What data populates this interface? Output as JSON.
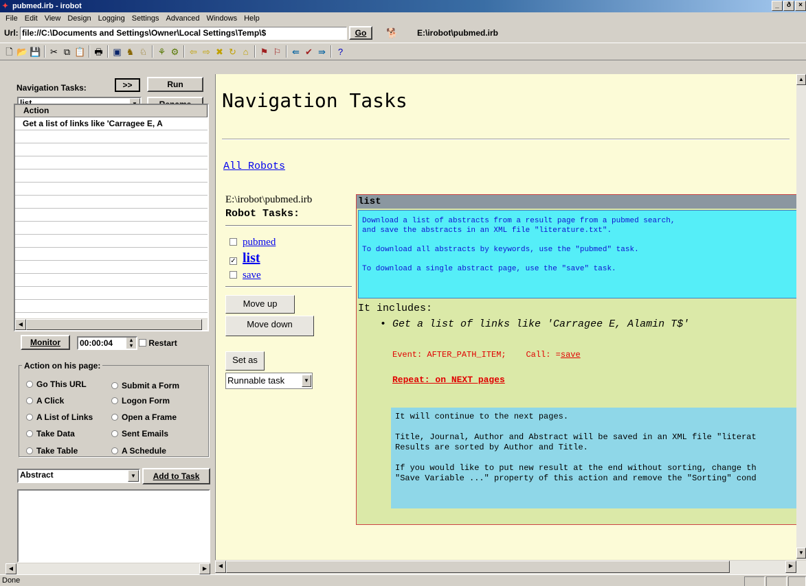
{
  "window": {
    "title": "pubmed.irb - irobot",
    "min": "_",
    "max": "ð",
    "close": "×"
  },
  "menu": [
    "File",
    "Edit",
    "View",
    "Design",
    "Logging",
    "Settings",
    "Advanced",
    "Windows",
    "Help"
  ],
  "urlbar": {
    "label": "Url:",
    "value": "file://C:\\Documents and Settings\\Owner\\Local Settings\\Temp\\$",
    "go": "Go",
    "path": "E:\\irobot\\pubmed.irb"
  },
  "left": {
    "nav_label": "Navigation Tasks:",
    "expand": ">>",
    "run": "Run",
    "task_combo": "list",
    "rename": "Rename",
    "action_header": "Action",
    "action_rows": [
      "Get a list of links like 'Carragee E, A"
    ],
    "monitor": "Monitor",
    "time": "00:00:04",
    "restart": "Restart",
    "group_label": "Action on his page:",
    "radios": [
      [
        "Go This URL",
        "Submit a Form"
      ],
      [
        "A Click",
        "Logon Form"
      ],
      [
        "A List of Links",
        "Open a Frame"
      ],
      [
        "Take Data",
        "Sent Emails"
      ],
      [
        "Take Table",
        "A Schedule"
      ]
    ],
    "data_combo": "Abstract",
    "add_task": "Add to Task"
  },
  "content": {
    "heading": "Navigation Tasks",
    "all_robots": "All Robots",
    "robot_path": "E:\\irobot\\pubmed.irb",
    "robot_tasks": "Robot Tasks:",
    "tasks": [
      {
        "name": "pubmed",
        "checked": false
      },
      {
        "name": "list",
        "checked": true
      },
      {
        "name": "save",
        "checked": false
      }
    ],
    "move_up": "Move up",
    "move_down": "Move down",
    "set_as": "Set as",
    "runnable": "Runnable task",
    "panel_title": "list",
    "description_lines": [
      "Download a list of abstracts from a result page from a pubmed search,",
      "and save the abstracts in an XML file \"literature.txt\".",
      "",
      "To download all abstracts by keywords, use the \"pubmed\" task.",
      "",
      "To download a single abstract page, use the \"save\" task."
    ],
    "includes": "It includes:",
    "bullet": "Get a list of links like 'Carragee E, Alamin T$'",
    "event_label": "Event: AFTER_PATH_ITEM;",
    "call_label": "Call: =",
    "call_link": "save",
    "repeat": "Repeat: on NEXT pages",
    "note_lines": [
      "It will continue to the next pages.",
      "",
      "Title, Journal, Author and Abstract will be saved in an XML file \"literat",
      "Results are sorted by Author and Title.",
      "",
      "If you would like to put new result at the end without sorting, change th",
      "\"Save Variable ...\" property of this action and remove the \"Sorting\" cond"
    ]
  },
  "status": {
    "text": "Done"
  },
  "colors": {
    "content_bg": "#fcfbd7",
    "desc_bg": "#55eef8",
    "panel_bg": "#dbe9a8",
    "note_bg": "#8fd7e8",
    "event_red": "#e00000"
  }
}
